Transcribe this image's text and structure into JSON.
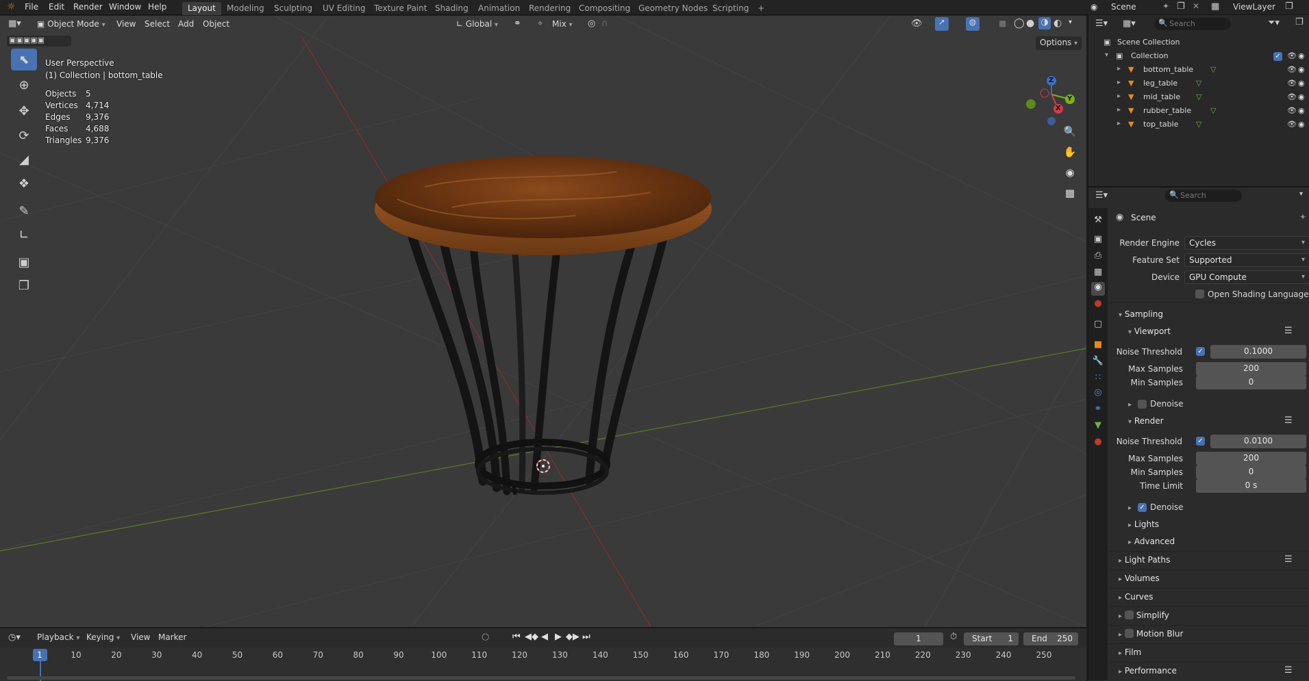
{
  "topbar": {
    "menus": [
      "File",
      "Edit",
      "Render",
      "Window",
      "Help"
    ],
    "workspaces": [
      "Layout",
      "Modeling",
      "Sculpting",
      "UV Editing",
      "Texture Paint",
      "Shading",
      "Animation",
      "Rendering",
      "Compositing",
      "Geometry Nodes",
      "Scripting"
    ],
    "add_tab": "+",
    "scene_name": "Scene",
    "view_layer": "ViewLayer"
  },
  "viewport": {
    "mode": "Object Mode",
    "menus": [
      "View",
      "Select",
      "Add",
      "Object"
    ],
    "transform_orientation": "Global",
    "snap": "Mix",
    "options_label": "Options",
    "perspective_label": "User Perspective",
    "active_info": "(1) Collection | bottom_table",
    "stats": [
      {
        "label": "Objects",
        "value": "5"
      },
      {
        "label": "Vertices",
        "value": "4,714"
      },
      {
        "label": "Edges",
        "value": "9,376"
      },
      {
        "label": "Faces",
        "value": "4,688"
      },
      {
        "label": "Triangles",
        "value": "9,376"
      }
    ],
    "gizmo": {
      "x": "X",
      "y": "Y",
      "z": "Z"
    }
  },
  "timeline": {
    "menus": [
      "Playback",
      "Keying",
      "View",
      "Marker"
    ],
    "current_frame": "1",
    "start_label": "Start",
    "start_value": "1",
    "end_label": "End",
    "end_value": "250",
    "ruler": [
      "1",
      "10",
      "20",
      "30",
      "40",
      "50",
      "60",
      "70",
      "80",
      "90",
      "100",
      "110",
      "120",
      "130",
      "140",
      "150",
      "160",
      "170",
      "180",
      "190",
      "200",
      "210",
      "220",
      "230",
      "240",
      "250"
    ]
  },
  "outliner": {
    "search_placeholder": "Search",
    "scene_collection": "Scene Collection",
    "collection": "Collection",
    "objects": [
      "bottom_table",
      "leg_table",
      "mid_table",
      "rubber_table",
      "top_table"
    ]
  },
  "properties": {
    "search_placeholder": "Search",
    "context": "Scene",
    "render_engine_label": "Render Engine",
    "render_engine": "Cycles",
    "feature_set_label": "Feature Set",
    "feature_set": "Supported",
    "device_label": "Device",
    "device": "GPU Compute",
    "osl_label": "Open Shading Language",
    "sampling": {
      "title": "Sampling",
      "viewport": {
        "title": "Viewport",
        "noise_threshold_label": "Noise Threshold",
        "noise_threshold": "0.1000",
        "max_samples_label": "Max Samples",
        "max_samples": "200",
        "min_samples_label": "Min Samples",
        "min_samples": "0",
        "denoise_label": "Denoise"
      },
      "render": {
        "title": "Render",
        "noise_threshold_label": "Noise Threshold",
        "noise_threshold": "0.0100",
        "max_samples_label": "Max Samples",
        "max_samples": "200",
        "min_samples_label": "Min Samples",
        "min_samples": "0",
        "time_limit_label": "Time Limit",
        "time_limit": "0 s",
        "denoise_label": "Denoise"
      },
      "lights": "Lights",
      "advanced": "Advanced"
    },
    "panels": [
      "Light Paths",
      "Volumes",
      "Curves",
      "Simplify",
      "Motion Blur",
      "Film",
      "Performance"
    ]
  }
}
